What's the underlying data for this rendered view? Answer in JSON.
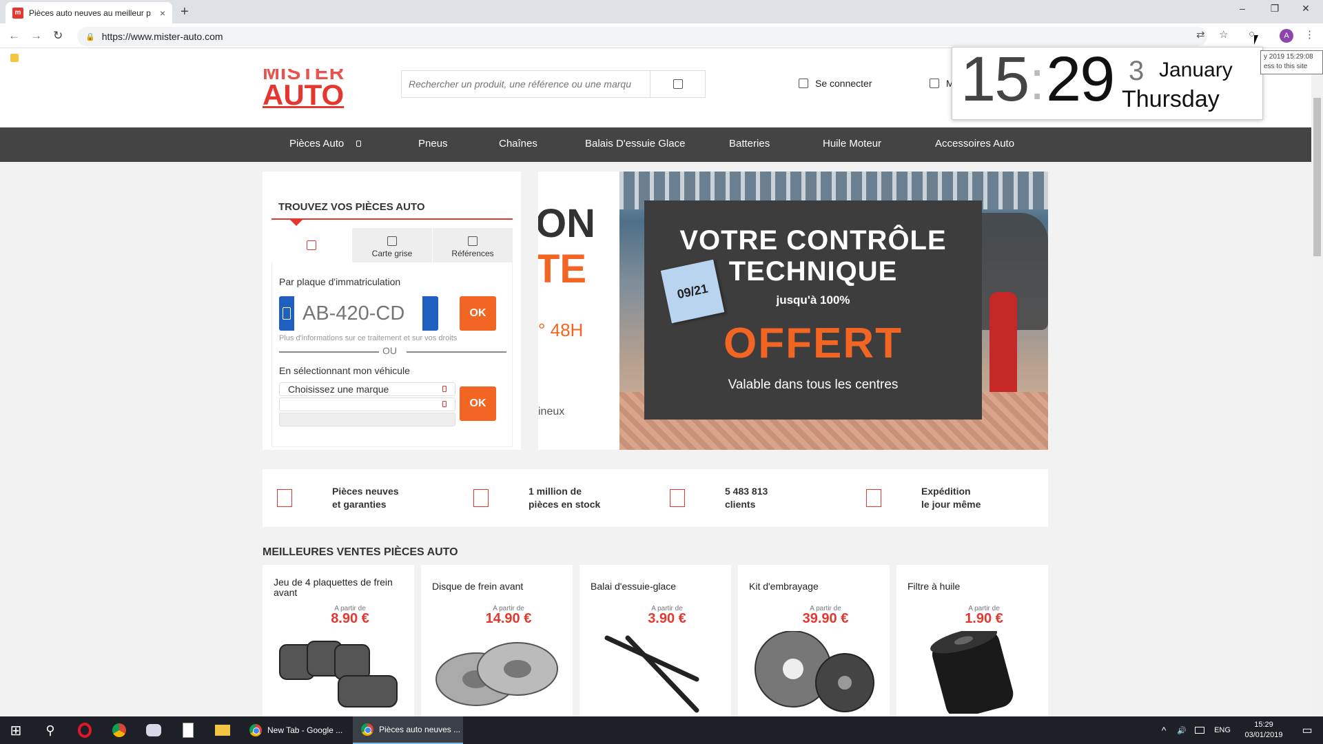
{
  "browser": {
    "tab_title": "Pièces auto neuves au meilleur p",
    "tab_favicon_letter": "m",
    "tab_close": "×",
    "new_tab": "+",
    "window_controls": [
      "–",
      "❐",
      "✕"
    ],
    "url": "https://www.mister-auto.com",
    "avatar_letter": "A",
    "nav_back": "←",
    "nav_forward": "→",
    "nav_reload": "↻",
    "lock": "🔒",
    "translate_icon": "⇄",
    "star_icon": "☆",
    "extension_icon": "○",
    "menu_icon": "⋮"
  },
  "header": {
    "logo_line1": "MISTER",
    "logo_line2": "AUTO",
    "search_placeholder": "Rechercher un produit, une référence ou une marqu",
    "login_label": "Se connecter",
    "cart_label": "M"
  },
  "menu": {
    "items": [
      "Pièces Auto",
      "Pneus",
      "Chaînes",
      "Balais D'essuie Glace",
      "Batteries",
      "Huile Moteur",
      "Accessoires Auto"
    ]
  },
  "finder": {
    "title": "TROUVEZ VOS PIÈCES AUTO",
    "tabs": [
      "",
      "Carte grise",
      "Références"
    ],
    "plate_label": "Par plaque d'immatriculation",
    "plate_placeholder": "AB-420-CD",
    "ok_label": "OK",
    "info": "Plus d'informations sur ce traitement et sur vos droits",
    "or_label": "OU",
    "vehicle_label": "En sélectionnant mon véhicule",
    "brand_select": "Choisissez une marque",
    "model_select": "",
    "ok2_label": "OK"
  },
  "banner": {
    "left_big1": "ON",
    "left_big2": "TE",
    "left_48h": "° 48H",
    "left_neux": "ineux",
    "line1": "VOTRE CONTRÔLE",
    "line2": "TECHNIQUE",
    "line3": "jusqu'à 100%",
    "line4": "OFFERT",
    "line5": "Valable dans tous les centres",
    "sticker": "09/21"
  },
  "features": [
    {
      "line1": "Pièces neuves",
      "line2": "et garanties"
    },
    {
      "line1": "1 million de",
      "line2": "pièces en stock"
    },
    {
      "line1": "5 483 813",
      "line2": "clients"
    },
    {
      "line1": "Expédition",
      "line2": "le jour même"
    }
  ],
  "best": {
    "title": "MEILLEURES VENTES PIÈCES AUTO",
    "cards": [
      {
        "name": "Jeu de 4 plaquettes de frein avant",
        "from": "A partir de",
        "price": "8.90 €"
      },
      {
        "name": "Disque de frein avant",
        "from": "A partir de",
        "price": "14.90 €"
      },
      {
        "name": "Balai d'essuie-glace",
        "from": "A partir de",
        "price": "3.90 €"
      },
      {
        "name": "Kit d'embrayage",
        "from": "A partir de",
        "price": "39.90 €"
      },
      {
        "name": "Filtre à huile",
        "from": "A partir de",
        "price": "1.90 €"
      }
    ]
  },
  "clock": {
    "hours": "15",
    "sep": ":",
    "minutes": "29",
    "day": "3",
    "month": "January",
    "weekday": "Thursday"
  },
  "tooltip": {
    "line1": "y 2019 15:29:08",
    "line2": "ess to this site"
  },
  "taskbar": {
    "apps": [
      {
        "label": "New Tab - Google ..."
      },
      {
        "label": "Pièces auto neuves ..."
      }
    ],
    "lang": "ENG",
    "time": "15:29",
    "date": "03/01/2019",
    "start_icon": "⊞",
    "search_icon": "⚲",
    "tray_up": "^",
    "tray_sound": "🔊",
    "notif": "▭"
  }
}
